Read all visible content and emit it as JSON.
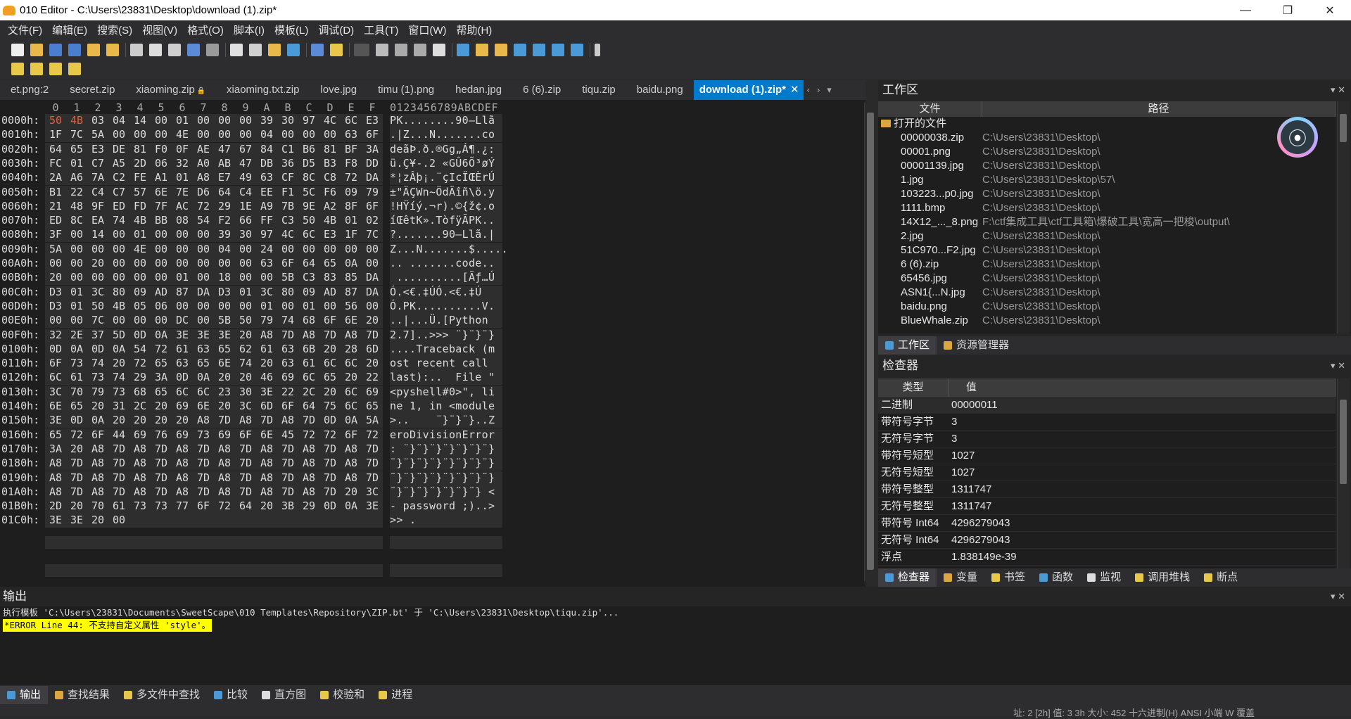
{
  "window": {
    "title": "010 Editor - C:\\Users\\23831\\Desktop\\download (1).zip*"
  },
  "menu": [
    "文件(F)",
    "编辑(E)",
    "搜索(S)",
    "视图(V)",
    "格式(O)",
    "脚本(I)",
    "模板(L)",
    "调试(D)",
    "工具(T)",
    "窗口(W)",
    "帮助(H)"
  ],
  "tabs": [
    {
      "label": "et.png:2"
    },
    {
      "label": "secret.zip"
    },
    {
      "label": "xiaoming.zip",
      "locked": true
    },
    {
      "label": "xiaoming.txt.zip"
    },
    {
      "label": "love.jpg"
    },
    {
      "label": "timu (1).png"
    },
    {
      "label": "hedan.jpg"
    },
    {
      "label": "6 (6).zip"
    },
    {
      "label": "tiqu.zip"
    },
    {
      "label": "baidu.png"
    },
    {
      "label": "download (1).zip*",
      "active": true
    }
  ],
  "hex": {
    "col_headers": [
      "0",
      "1",
      "2",
      "3",
      "4",
      "5",
      "6",
      "7",
      "8",
      "9",
      "A",
      "B",
      "C",
      "D",
      "E",
      "F"
    ],
    "ascii_header": "0123456789ABCDEF",
    "rows": [
      {
        "addr": "0000h:",
        "bytes": [
          "50",
          "4B",
          "03",
          "04",
          "14",
          "00",
          "01",
          "00",
          "00",
          "00",
          "39",
          "30",
          "97",
          "4C",
          "6C",
          "E3"
        ],
        "ascii": "PK........90—Llã"
      },
      {
        "addr": "0010h:",
        "bytes": [
          "1F",
          "7C",
          "5A",
          "00",
          "00",
          "00",
          "4E",
          "00",
          "00",
          "00",
          "04",
          "00",
          "00",
          "00",
          "63",
          "6F"
        ],
        "ascii": ".|Z...N.......co"
      },
      {
        "addr": "0020h:",
        "bytes": [
          "64",
          "65",
          "E3",
          "DE",
          "81",
          "F0",
          "0F",
          "AE",
          "47",
          "67",
          "84",
          "C1",
          "B6",
          "81",
          "BF",
          "3A"
        ],
        "ascii": "deãÞ.ð.®Gg„Á¶.¿:"
      },
      {
        "addr": "0030h:",
        "bytes": [
          "FC",
          "01",
          "C7",
          "A5",
          "2D",
          "06",
          "32",
          "A0",
          "AB",
          "47",
          "DB",
          "36",
          "D5",
          "B3",
          "F8",
          "DD"
        ],
        "ascii": "ü.Ç¥-.2 «GÛ6Õ³øÝ"
      },
      {
        "addr": "0040h:",
        "bytes": [
          "2A",
          "A6",
          "7A",
          "C2",
          "FE",
          "A1",
          "01",
          "A8",
          "E7",
          "49",
          "63",
          "CF",
          "8C",
          "C8",
          "72",
          "DA"
        ],
        "ascii": "*¦zÂþ¡.¨çIcÏŒÈrÚ"
      },
      {
        "addr": "0050h:",
        "bytes": [
          "B1",
          "22",
          "C4",
          "C7",
          "57",
          "6E",
          "7E",
          "D6",
          "64",
          "C4",
          "EE",
          "F1",
          "5C",
          "F6",
          "09",
          "79"
        ],
        "ascii": "±\"ÄÇWn~ÖdÄîñ\\ö.y"
      },
      {
        "addr": "0060h:",
        "bytes": [
          "21",
          "48",
          "9F",
          "ED",
          "FD",
          "7F",
          "AC",
          "72",
          "29",
          "1E",
          "A9",
          "7B",
          "9E",
          "A2",
          "8F",
          "6F"
        ],
        "ascii": "!HŸíý.¬r).©{ž¢.o"
      },
      {
        "addr": "0070h:",
        "bytes": [
          "ED",
          "8C",
          "EA",
          "74",
          "4B",
          "BB",
          "08",
          "54",
          "F2",
          "66",
          "FF",
          "C3",
          "50",
          "4B",
          "01",
          "02"
        ],
        "ascii": "íŒêtK».TòfÿÃPK.."
      },
      {
        "addr": "0080h:",
        "bytes": [
          "3F",
          "00",
          "14",
          "00",
          "01",
          "00",
          "00",
          "00",
          "39",
          "30",
          "97",
          "4C",
          "6C",
          "E3",
          "1F",
          "7C"
        ],
        "ascii": "?.......90—Llã.|"
      },
      {
        "addr": "0090h:",
        "bytes": [
          "5A",
          "00",
          "00",
          "00",
          "4E",
          "00",
          "00",
          "00",
          "04",
          "00",
          "24",
          "00",
          "00",
          "00",
          "00",
          "00"
        ],
        "ascii": "Z...N.......$....."
      },
      {
        "addr": "00A0h:",
        "bytes": [
          "00",
          "00",
          "20",
          "00",
          "00",
          "00",
          "00",
          "00",
          "00",
          "00",
          "63",
          "6F",
          "64",
          "65",
          "0A",
          "00"
        ],
        "ascii": ".. .......code.."
      },
      {
        "addr": "00B0h:",
        "bytes": [
          "20",
          "00",
          "00",
          "00",
          "00",
          "00",
          "01",
          "00",
          "18",
          "00",
          "00",
          "5B",
          "C3",
          "83",
          "85",
          "DA"
        ],
        "ascii": " ..........[Ãƒ…Ú"
      },
      {
        "addr": "00C0h:",
        "bytes": [
          "D3",
          "01",
          "3C",
          "80",
          "09",
          "AD",
          "87",
          "DA",
          "D3",
          "01",
          "3C",
          "80",
          "09",
          "AD",
          "87",
          "DA"
        ],
        "ascii": "Ó.<€.­‡ÚÓ.<€.­‡Ú"
      },
      {
        "addr": "00D0h:",
        "bytes": [
          "D3",
          "01",
          "50",
          "4B",
          "05",
          "06",
          "00",
          "00",
          "00",
          "00",
          "01",
          "00",
          "01",
          "00",
          "56",
          "00"
        ],
        "ascii": "Ó.PK..........V."
      },
      {
        "addr": "00E0h:",
        "bytes": [
          "00",
          "00",
          "7C",
          "00",
          "00",
          "00",
          "DC",
          "00",
          "5B",
          "50",
          "79",
          "74",
          "68",
          "6F",
          "6E",
          "20"
        ],
        "ascii": "..|...Ü.[Python "
      },
      {
        "addr": "00F0h:",
        "bytes": [
          "32",
          "2E",
          "37",
          "5D",
          "0D",
          "0A",
          "3E",
          "3E",
          "3E",
          "20",
          "A8",
          "7D",
          "A8",
          "7D",
          "A8",
          "7D"
        ],
        "ascii": "2.7]..>>> ¨}¨}¨}"
      },
      {
        "addr": "0100h:",
        "bytes": [
          "0D",
          "0A",
          "0D",
          "0A",
          "54",
          "72",
          "61",
          "63",
          "65",
          "62",
          "61",
          "63",
          "6B",
          "20",
          "28",
          "6D"
        ],
        "ascii": "....Traceback (m"
      },
      {
        "addr": "0110h:",
        "bytes": [
          "6F",
          "73",
          "74",
          "20",
          "72",
          "65",
          "63",
          "65",
          "6E",
          "74",
          "20",
          "63",
          "61",
          "6C",
          "6C",
          "20"
        ],
        "ascii": "ost recent call "
      },
      {
        "addr": "0120h:",
        "bytes": [
          "6C",
          "61",
          "73",
          "74",
          "29",
          "3A",
          "0D",
          "0A",
          "20",
          "20",
          "46",
          "69",
          "6C",
          "65",
          "20",
          "22"
        ],
        "ascii": "last):..  File \""
      },
      {
        "addr": "0130h:",
        "bytes": [
          "3C",
          "70",
          "79",
          "73",
          "68",
          "65",
          "6C",
          "6C",
          "23",
          "30",
          "3E",
          "22",
          "2C",
          "20",
          "6C",
          "69"
        ],
        "ascii": "<pyshell#0>\", li"
      },
      {
        "addr": "0140h:",
        "bytes": [
          "6E",
          "65",
          "20",
          "31",
          "2C",
          "20",
          "69",
          "6E",
          "20",
          "3C",
          "6D",
          "6F",
          "64",
          "75",
          "6C",
          "65"
        ],
        "ascii": "ne 1, in <module"
      },
      {
        "addr": "0150h:",
        "bytes": [
          "3E",
          "0D",
          "0A",
          "20",
          "20",
          "20",
          "20",
          "A8",
          "7D",
          "A8",
          "7D",
          "A8",
          "7D",
          "0D",
          "0A",
          "5A"
        ],
        "ascii": ">..    ¨}¨}¨}..Z"
      },
      {
        "addr": "0160h:",
        "bytes": [
          "65",
          "72",
          "6F",
          "44",
          "69",
          "76",
          "69",
          "73",
          "69",
          "6F",
          "6E",
          "45",
          "72",
          "72",
          "6F",
          "72"
        ],
        "ascii": "eroDivisionError"
      },
      {
        "addr": "0170h:",
        "bytes": [
          "3A",
          "20",
          "A8",
          "7D",
          "A8",
          "7D",
          "A8",
          "7D",
          "A8",
          "7D",
          "A8",
          "7D",
          "A8",
          "7D",
          "A8",
          "7D"
        ],
        "ascii": ": ¨}¨}¨}¨}¨}¨}¨}"
      },
      {
        "addr": "0180h:",
        "bytes": [
          "A8",
          "7D",
          "A8",
          "7D",
          "A8",
          "7D",
          "A8",
          "7D",
          "A8",
          "7D",
          "A8",
          "7D",
          "A8",
          "7D",
          "A8",
          "7D"
        ],
        "ascii": "¨}¨}¨}¨}¨}¨}¨}¨}"
      },
      {
        "addr": "0190h:",
        "bytes": [
          "A8",
          "7D",
          "A8",
          "7D",
          "A8",
          "7D",
          "A8",
          "7D",
          "A8",
          "7D",
          "A8",
          "7D",
          "A8",
          "7D",
          "A8",
          "7D"
        ],
        "ascii": "¨}¨}¨}¨}¨}¨}¨}¨}"
      },
      {
        "addr": "01A0h:",
        "bytes": [
          "A8",
          "7D",
          "A8",
          "7D",
          "A8",
          "7D",
          "A8",
          "7D",
          "A8",
          "7D",
          "A8",
          "7D",
          "A8",
          "7D",
          "20",
          "3C"
        ],
        "ascii": "¨}¨}¨}¨}¨}¨}¨} <"
      },
      {
        "addr": "01B0h:",
        "bytes": [
          "2D",
          "20",
          "70",
          "61",
          "73",
          "73",
          "77",
          "6F",
          "72",
          "64",
          "20",
          "3B",
          "29",
          "0D",
          "0A",
          "3E"
        ],
        "ascii": "- password ;)..>"
      },
      {
        "addr": "01C0h:",
        "bytes": [
          "3E",
          "3E",
          "20",
          "00"
        ],
        "ascii": ">> ."
      }
    ]
  },
  "workspace": {
    "title": "工作区",
    "col_file": "文件",
    "col_path": "路径",
    "group": "打开的文件",
    "files": [
      {
        "name": "00000038.zip",
        "path": "C:\\Users\\23831\\Desktop\\"
      },
      {
        "name": "00001.png",
        "path": "C:\\Users\\23831\\Desktop\\"
      },
      {
        "name": "00001139.jpg",
        "path": "C:\\Users\\23831\\Desktop\\"
      },
      {
        "name": "1.jpg",
        "path": "C:\\Users\\23831\\Desktop\\57\\"
      },
      {
        "name": "103223...p0.jpg",
        "path": "C:\\Users\\23831\\Desktop\\"
      },
      {
        "name": "1111.bmp",
        "path": "C:\\Users\\23831\\Desktop\\"
      },
      {
        "name": "14X12_..._8.png",
        "path": "F:\\ctf集成工具\\ctf工具箱\\爆破工具\\宽高一把梭\\output\\"
      },
      {
        "name": "2.jpg",
        "path": "C:\\Users\\23831\\Desktop\\"
      },
      {
        "name": "51C970...F2.jpg",
        "path": "C:\\Users\\23831\\Desktop\\"
      },
      {
        "name": "6 (6).zip",
        "path": "C:\\Users\\23831\\Desktop\\"
      },
      {
        "name": "65456.jpg",
        "path": "C:\\Users\\23831\\Desktop\\"
      },
      {
        "name": "ASN1{...N.jpg",
        "path": "C:\\Users\\23831\\Desktop\\"
      },
      {
        "name": "baidu.png",
        "path": "C:\\Users\\23831\\Desktop\\"
      },
      {
        "name": "BlueWhale.zip",
        "path": "C:\\Users\\23831\\Desktop\\"
      }
    ],
    "tabs": [
      {
        "label": "工作区",
        "active": true
      },
      {
        "label": "资源管理器"
      }
    ]
  },
  "inspector": {
    "title": "检查器",
    "col_type": "类型",
    "col_value": "值",
    "rows": [
      {
        "k": "二进制",
        "v": "00000011"
      },
      {
        "k": "带符号字节",
        "v": "3"
      },
      {
        "k": "无符号字节",
        "v": "3"
      },
      {
        "k": "带符号短型",
        "v": "1027"
      },
      {
        "k": "无符号短型",
        "v": "1027"
      },
      {
        "k": "带符号整型",
        "v": "1311747"
      },
      {
        "k": "无符号整型",
        "v": "1311747"
      },
      {
        "k": "带符号 Int64",
        "v": "4296279043"
      },
      {
        "k": "无符号 Int64",
        "v": "4296279043"
      },
      {
        "k": "浮点",
        "v": "1.838149e-39"
      }
    ],
    "tabs": [
      {
        "label": "检查器",
        "active": true
      },
      {
        "label": "变量"
      },
      {
        "label": "书签"
      },
      {
        "label": "函数"
      },
      {
        "label": "监视"
      },
      {
        "label": "调用堆栈"
      },
      {
        "label": "断点"
      }
    ]
  },
  "output": {
    "title": "输出",
    "line1": "执行模板 'C:\\Users\\23831\\Documents\\SweetScape\\010 Templates\\Repository\\ZIP.bt' 于 'C:\\Users\\23831\\Desktop\\tiqu.zip'...",
    "error": "*ERROR Line 44: 不支持自定义属性 'style'。"
  },
  "bottom_tabs": [
    {
      "label": "输出",
      "active": true
    },
    {
      "label": "查找结果"
    },
    {
      "label": "多文件中查找"
    },
    {
      "label": "比较"
    },
    {
      "label": "直方图"
    },
    {
      "label": "校验和"
    },
    {
      "label": "进程"
    }
  ],
  "status": "址: 2 [2h]  值: 3 3h  大小: 452        十六进制(H)  ANSI  小端      W  覆盖",
  "colors": {
    "accent": "#007acc",
    "error_bg": "#ffff00",
    "byte_highlight": "#e06040"
  }
}
